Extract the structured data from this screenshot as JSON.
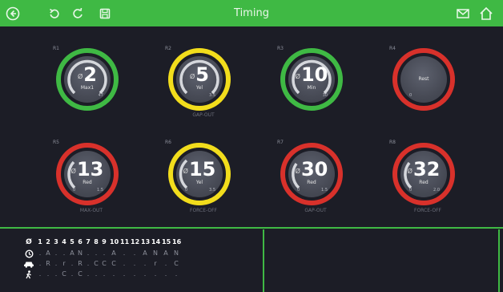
{
  "topbar": {
    "title": "Timing",
    "left_icons": [
      "back-icon",
      "undo-icon",
      "refresh-icon",
      "save-icon"
    ],
    "right_icons": [
      "mail-icon",
      "home-icon"
    ],
    "accent": "#3fb944"
  },
  "colors": {
    "green": "#3fb944",
    "yellow": "#f2dd1c",
    "red": "#d8312b"
  },
  "rings": [
    {
      "id": "R1",
      "value": "2",
      "status": "Max1",
      "lo": "",
      "hi": "47",
      "color": "green",
      "caption": ""
    },
    {
      "id": "R2",
      "value": "5",
      "status": "Yel",
      "lo": "",
      "hi": "3.5",
      "color": "yellow",
      "caption": "GAP-OUT"
    },
    {
      "id": "R3",
      "value": "10",
      "status": "Min",
      "lo": "",
      "hi": "30",
      "color": "green",
      "caption": ""
    },
    {
      "id": "R4",
      "value": "",
      "status": "Rest",
      "lo": "0",
      "hi": "",
      "color": "red",
      "caption": ""
    },
    {
      "id": "R5",
      "value": "13",
      "status": "Red",
      "lo": "0",
      "hi": "1.5",
      "color": "red",
      "caption": "MAX-OUT"
    },
    {
      "id": "R6",
      "value": "15",
      "status": "Yel",
      "lo": "0",
      "hi": "3.5",
      "color": "yellow",
      "caption": "FORCE-OFF"
    },
    {
      "id": "R7",
      "value": "30",
      "status": "Red",
      "lo": "0",
      "hi": "1.5",
      "color": "red",
      "caption": "GAP-OUT"
    },
    {
      "id": "R8",
      "value": "32",
      "status": "Red",
      "lo": "0",
      "hi": "2.0",
      "color": "red",
      "caption": "FORCE-OFF"
    }
  ],
  "phase_table": {
    "header": [
      "Ø",
      "1",
      "2",
      "3",
      "4",
      "5",
      "6",
      "7",
      "8",
      "9",
      "10",
      "11",
      "12",
      "13",
      "14",
      "15",
      "16"
    ],
    "rows": [
      {
        "icon": "clock-icon",
        "cells": [
          ".",
          "A",
          ".",
          ".",
          "A",
          "N",
          ".",
          ".",
          ".",
          "A",
          ".",
          ".",
          "A",
          "N",
          "A",
          "N"
        ]
      },
      {
        "icon": "car-icon",
        "cells": [
          ".",
          "R",
          ".",
          "r",
          ".",
          "R",
          ".",
          "C",
          "C",
          "C",
          ".",
          ".",
          ".",
          "r",
          ".",
          "C"
        ]
      },
      {
        "icon": "pedestrian-icon",
        "cells": [
          ".",
          ".",
          ".",
          "C",
          ".",
          "C",
          ".",
          ".",
          ".",
          ".",
          ".",
          ".",
          ".",
          ".",
          ".",
          "."
        ]
      }
    ]
  }
}
